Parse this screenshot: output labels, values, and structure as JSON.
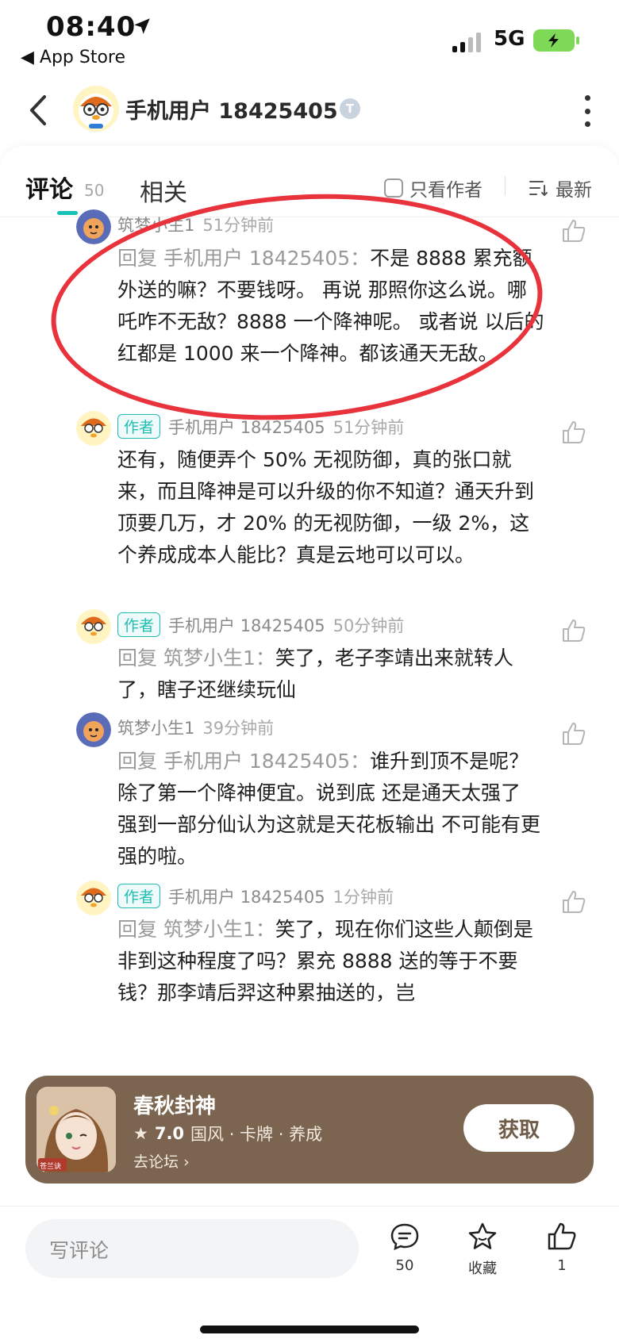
{
  "status_bar": {
    "time": "08:40",
    "back_app": "◀ App Store",
    "network": "5G"
  },
  "header": {
    "title": "手机用户 18425405",
    "badge": "T"
  },
  "tabs": {
    "comments_label": "评论",
    "comments_count": "50",
    "related_label": "相关",
    "author_only": "只看作者",
    "sort": "最新"
  },
  "comments": [
    {
      "name": "筑梦小生1",
      "tag": "",
      "time": "51分钟前",
      "reply": "回复 手机用户 18425405：",
      "text": "不是 8888 累充额外送的嘛？不要钱呀。 再说 那照你这么说。哪吒咋不无敌？8888 一个降神呢。 或者说 以后的红都是 1000 来一个降神。都该通天无敌。"
    },
    {
      "name": "手机用户 18425405",
      "tag": "作者",
      "time": "51分钟前",
      "reply": "",
      "text": "还有，随便弄个 50% 无视防御，真的张口就来，而且降神是可以升级的你不知道？通天升到顶要几万，才 20% 的无视防御，一级 2%，这个养成成本人能比？真是云地可以可以。"
    },
    {
      "name": "手机用户 18425405",
      "tag": "作者",
      "time": "50分钟前",
      "reply": "回复 筑梦小生1：",
      "text": "笑了，老子李靖出来就转人了，瞎子还继续玩仙"
    },
    {
      "name": "筑梦小生1",
      "tag": "",
      "time": "39分钟前",
      "reply": "回复 手机用户 18425405：",
      "text": "谁升到顶不是呢？除了第一个降神便宜。说到底 还是通天太强了 强到一部分仙认为这就是天花板输出 不可能有更强的啦。"
    },
    {
      "name": "手机用户 18425405",
      "tag": "作者",
      "time": "1分钟前",
      "reply": "回复 筑梦小生1：",
      "text": "笑了，现在你们这些人颠倒是非到这种程度了吗？累充 8888 送的等于不要钱？那李靖后羿这种累抽送的，岂"
    }
  ],
  "game_banner": {
    "name": "春秋封神",
    "score": "7.0",
    "tags": "国风 · 卡牌 · 养成",
    "forum_link": "去论坛",
    "get_button": "获取",
    "thumb_caption": "苍兰诀"
  },
  "bottom_bar": {
    "write_placeholder": "写评论",
    "comment_count": "50",
    "favorite_label": "收藏",
    "like_count": "1"
  },
  "colors": {
    "accent": "#16c2b8",
    "annotation_circle": "#e8323c",
    "banner_bg": "#7c6550"
  }
}
